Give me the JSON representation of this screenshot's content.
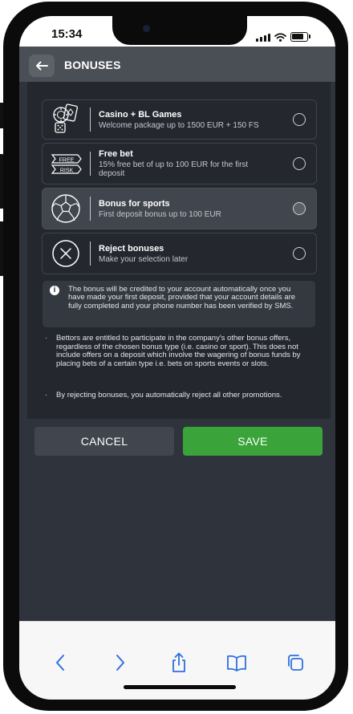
{
  "status_bar": {
    "time": "15:34",
    "battery_level": 0.85
  },
  "header": {
    "title": "BONUSES",
    "back_icon": "arrow-left-icon"
  },
  "options": [
    {
      "title": "Casino + BL Games",
      "subtitle": "Welcome package up to 1500 EUR + 150 FS",
      "icon": "casino-chips-icon",
      "selected": false
    },
    {
      "title": "Free bet",
      "subtitle": "15% free bet of up to 100 EUR for the first deposit",
      "icon": "free-risk-icon",
      "icon_text_top": "FREE",
      "icon_text_bottom": "RISK",
      "selected": false
    },
    {
      "title": "Bonus for sports",
      "subtitle": "First deposit bonus up to 100 EUR",
      "icon": "soccer-ball-icon",
      "selected": true
    },
    {
      "title": "Reject bonuses",
      "subtitle": "Make your selection later",
      "icon": "reject-x-icon",
      "selected": false
    }
  ],
  "info": {
    "icon": "info-icon",
    "text": "The bonus will be credited to your account automatically once you have made your first deposit, provided that your account details are fully completed and your phone number has been verified by SMS."
  },
  "bullets": [
    "Bettors are entitled to participate in the company's other bonus offers, regardless of the chosen bonus type (i.e. casino or sport). This does not include offers on a deposit which involve the wagering of bonus funds by placing bets of a certain type i.e. bets on sports events or slots.",
    "By rejecting bonuses, you automatically reject all other promotions."
  ],
  "buttons": {
    "cancel": "CANCEL",
    "save": "SAVE"
  },
  "colors": {
    "save_green": "#3aa43a",
    "header_bg": "#4a4e55",
    "panel_bg": "#24272e",
    "page_bg": "#2f333b",
    "selected_option_bg": "#41454d"
  },
  "browser_toolbar": {
    "icons": [
      "chevron-back-icon",
      "chevron-forward-icon",
      "share-icon",
      "bookmarks-icon",
      "tabs-icon"
    ]
  }
}
